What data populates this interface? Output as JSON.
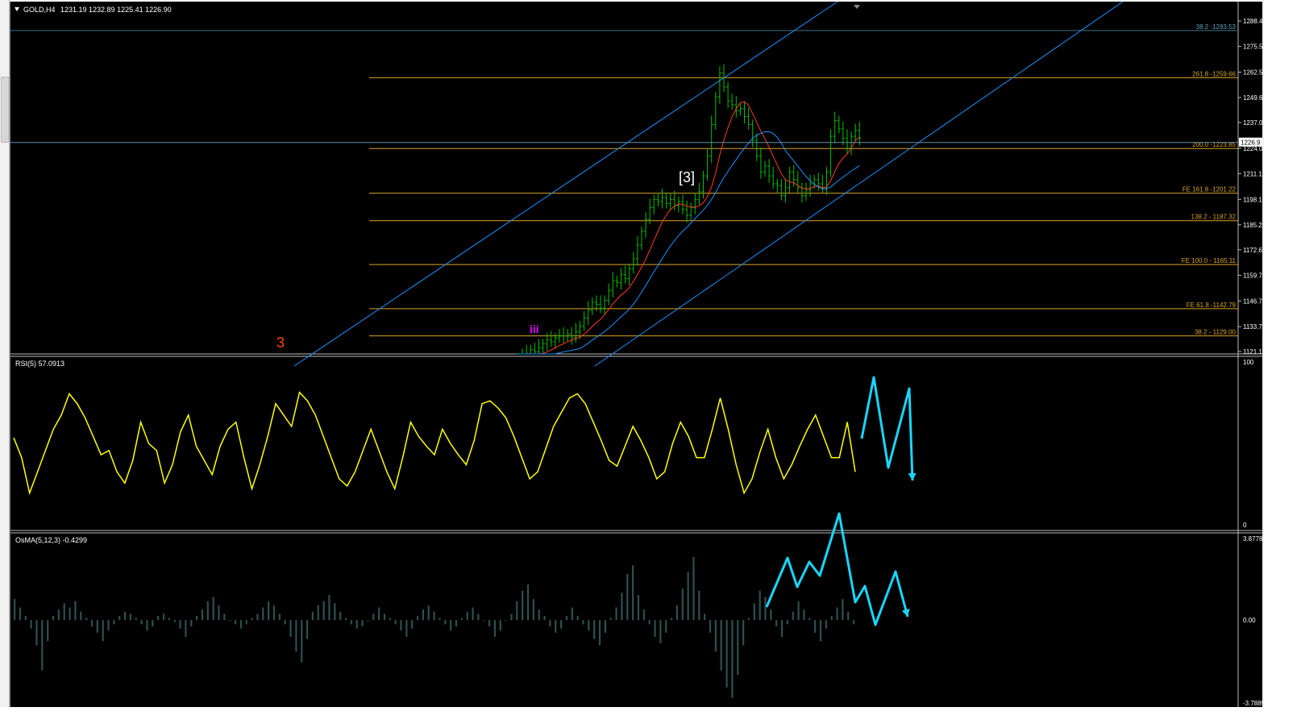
{
  "header": {
    "symbol_label": "GOLD,H4",
    "ohlc": "1231.19 1232.89 1225.41 1226.90",
    "rsi_label": "RSI(5) 57.0913",
    "osma_label": "OsMA(5,12,3) -0.4299"
  },
  "wave_labels": {
    "red_three": "3",
    "bracket_three": "[3]",
    "roman_three": "iii"
  },
  "colors": {
    "background": "#000000",
    "candles": "#00c000",
    "fib_levels": "#daa520",
    "channel": "#1e90ff",
    "ma_red": "#ff3b1f",
    "ma_blue": "#1e90ff",
    "rsi": "#ffff00",
    "osma_hist": "#2f4f4f",
    "projection": "#19d6ff",
    "wave_red": "#ff4500",
    "wave_white": "#ffffff",
    "wave_magenta": "#e400ff"
  },
  "chart_data": [
    {
      "type": "candlestick",
      "title": "GOLD,H4",
      "y_axis_ticks": [
        "1288.4",
        "1275.5",
        "1262.5",
        "1249.6",
        "1237.0",
        "1224.0",
        "1211.1",
        "1198.1",
        "1185.2",
        "1172.6",
        "1159.7",
        "1146.7",
        "1133.7",
        "1121.1"
      ],
      "current_price": "1226.9",
      "ylim": [
        1121.1,
        1288.4
      ],
      "fib_levels": [
        {
          "label": "38.2 -1283.53",
          "value": 1283.53
        },
        {
          "label": "261.8 -1259.66",
          "value": 1259.66
        },
        {
          "label": "200.0 -1223.85",
          "value": 1223.85
        },
        {
          "label": "FE 161.8 -1201.22",
          "value": 1201.22
        },
        {
          "label": "138.2 - 1187.32",
          "value": 1187.32
        },
        {
          "label": "FE 100.0 - 1165.11",
          "value": 1165.11
        },
        {
          "label": "FE 61.8 -1142.79",
          "value": 1142.79
        },
        {
          "label": "38.2 - 1129.00",
          "value": 1129.0
        }
      ],
      "price_path": [
        1118,
        1119,
        1120,
        1122,
        1121,
        1123,
        1125,
        1127,
        1126,
        1128,
        1129,
        1129,
        1130,
        1128,
        1131,
        1134,
        1138,
        1142,
        1146,
        1145,
        1143,
        1147,
        1152,
        1157,
        1156,
        1160,
        1158,
        1163,
        1168,
        1175,
        1182,
        1188,
        1194,
        1198,
        1197,
        1199,
        1196,
        1198,
        1195,
        1197,
        1193,
        1190,
        1194,
        1198,
        1202,
        1210,
        1220,
        1236,
        1250,
        1262,
        1255,
        1248,
        1246,
        1243,
        1244,
        1240,
        1236,
        1228,
        1220,
        1212,
        1215,
        1210,
        1206,
        1205,
        1200,
        1204,
        1212,
        1208,
        1204,
        1200,
        1203,
        1206,
        1208,
        1206,
        1204,
        1212,
        1230,
        1238,
        1234,
        1229,
        1224,
        1230,
        1233,
        1229
      ]
    },
    {
      "type": "line",
      "title": "RSI(5) 57.0913",
      "y_axis_ticks": [
        "100",
        "0"
      ],
      "ylim": [
        0,
        100
      ],
      "series": [
        {
          "name": "RSI(5)",
          "values": [
            54,
            40,
            15,
            30,
            45,
            60,
            70,
            85,
            78,
            68,
            55,
            42,
            45,
            30,
            22,
            38,
            65,
            50,
            45,
            22,
            35,
            58,
            70,
            48,
            38,
            28,
            48,
            60,
            65,
            40,
            18,
            35,
            55,
            78,
            70,
            62,
            86,
            80,
            70,
            55,
            40,
            25,
            20,
            30,
            45,
            60,
            45,
            30,
            18,
            40,
            65,
            55,
            48,
            42,
            60,
            50,
            42,
            35,
            52,
            78,
            80,
            75,
            68,
            55,
            40,
            25,
            30,
            46,
            62,
            72,
            82,
            85,
            78,
            65,
            52,
            38,
            34,
            48,
            62,
            52,
            40,
            25,
            30,
            50,
            65,
            55,
            40,
            40,
            60,
            82,
            60,
            35,
            15,
            25,
            44,
            60,
            40,
            25,
            35,
            48,
            60,
            70,
            55,
            40,
            40,
            65,
            30
          ]
        }
      ]
    },
    {
      "type": "bar",
      "title": "OsMA(5,12,3) -0.4299",
      "y_axis_ticks": [
        "3.8778",
        "0.00",
        "-3.7889"
      ],
      "ylim": [
        -3.7889,
        3.8778
      ],
      "series": [
        {
          "name": "OsMA",
          "values": [
            1.0,
            0.6,
            0.2,
            -0.4,
            -1.2,
            -2.4,
            -1.0,
            0.2,
            0.5,
            0.8,
            0.6,
            0.9,
            0.4,
            0.1,
            -0.3,
            -0.6,
            -1.0,
            -0.5,
            -0.2,
            0.2,
            0.4,
            0.3,
            0.1,
            -0.2,
            -0.5,
            -0.3,
            0.2,
            0.3,
            0.1,
            -0.1,
            -0.4,
            -0.8,
            -0.3,
            0.2,
            0.5,
            0.9,
            1.1,
            0.7,
            0.3,
            0.0,
            -0.2,
            -0.4,
            -0.2,
            0.1,
            0.3,
            0.6,
            0.9,
            0.7,
            0.3,
            -0.2,
            -0.8,
            -1.5,
            -2.0,
            -0.9,
            0.4,
            0.7,
            0.9,
            1.2,
            0.8,
            0.4,
            0.1,
            -0.2,
            -0.4,
            -0.3,
            0.0,
            0.3,
            0.6,
            0.3,
            0.1,
            -0.2,
            -0.5,
            -0.8,
            -0.4,
            0.2,
            0.5,
            0.7,
            0.4,
            0.1,
            -0.2,
            -0.5,
            -0.3,
            0.1,
            0.4,
            0.6,
            0.3,
            0.0,
            -0.3,
            -0.8,
            -0.5,
            0.0,
            0.3,
            0.9,
            1.4,
            1.7,
            1.0,
            0.5,
            0.2,
            -0.3,
            -0.6,
            -0.4,
            0.2,
            0.6,
            0.2,
            -0.2,
            -0.5,
            -0.9,
            -1.2,
            -0.6,
            0.1,
            0.6,
            1.3,
            2.2,
            2.6,
            1.2,
            0.5,
            -0.2,
            -0.8,
            -1.1,
            -0.6,
            0.1,
            0.7,
            1.5,
            2.3,
            3.0,
            1.4,
            0.3,
            -0.6,
            -1.5,
            -2.4,
            -3.2,
            -3.7,
            -2.6,
            -1.2,
            0.1,
            0.8,
            1.4,
            1.1,
            0.5,
            -0.3,
            -0.8,
            -0.2,
            0.4,
            0.9,
            0.5,
            0.1,
            -0.6,
            -1.0,
            -0.4,
            0.2,
            0.6,
            1.0,
            0.4,
            -0.2
          ]
        }
      ]
    }
  ]
}
